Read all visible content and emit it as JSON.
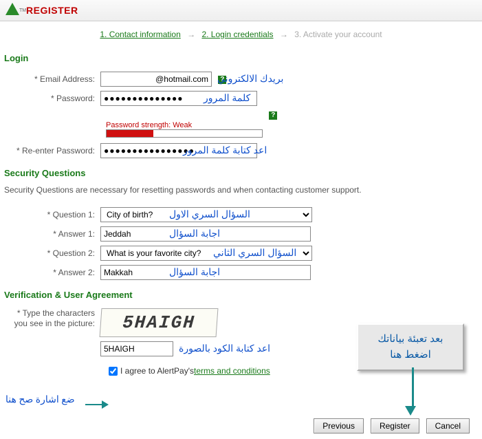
{
  "header": {
    "title": "REGISTER",
    "tm": "TM"
  },
  "steps": {
    "s1": "1. Contact information",
    "s2": "2. Login credentials",
    "s3": "3. Activate your account",
    "arrow": "→"
  },
  "sections": {
    "login": "Login",
    "security": "Security Questions",
    "security_desc": "Security Questions are necessary for resetting passwords and when contacting customer support.",
    "verification": "Verification & User Agreement"
  },
  "labels": {
    "email": "* Email Address:",
    "password": "* Password:",
    "repassword": "* Re-enter Password:",
    "q1": "* Question 1:",
    "a1": "* Answer 1:",
    "q2": "* Question 2:",
    "a2": "* Answer 2:",
    "captcha": "* Type the characters you see in the picture:"
  },
  "values": {
    "email": "@hotmail.com",
    "password": "●●●●●●●●●●●●●●",
    "repassword": "●●●●●●●●●●●●●●●●",
    "q1": "City of birth?",
    "a1": "Jeddah",
    "q2": "What is your favorite city?",
    "a2": "Makkah",
    "captcha_text": "5HAIGH",
    "captcha_input": "5HAIGH"
  },
  "pw_strength": {
    "label": "Password strength: Weak",
    "percent": 30,
    "color": "#d01010"
  },
  "overlays": {
    "email": "بريدك الالكتروني",
    "password": "كلمة المرور",
    "repassword": "اعد كتابة كلمة المرور",
    "q1": "السؤال السري الاول",
    "a1": "اجابة السؤال",
    "q2": "السؤال السري الثاني",
    "a2": "اجابة السؤال",
    "captcha": "اعد كتابة الكود بالصورة",
    "checkbox_hint": "ضع اشارة صح هنا",
    "note_line1": "بعد تعبئة بياناتك",
    "note_line2": "اضغط هنا"
  },
  "agree": {
    "prefix": "I agree to AlertPay's ",
    "link": "terms and conditions"
  },
  "buttons": {
    "previous": "Previous",
    "register": "Register",
    "cancel": "Cancel"
  },
  "help_icon": "?"
}
